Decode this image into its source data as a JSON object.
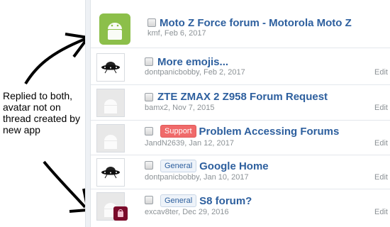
{
  "annotation": {
    "text": "Replied to both, avatar not on thread created by new app"
  },
  "threads": [
    {
      "title": "Moto Z Force forum - Motorola Moto Z",
      "author": "kmf",
      "date": "Feb 6, 2017",
      "edit": "",
      "prefix": "",
      "avatar": "android-icon"
    },
    {
      "title": "More emojis...",
      "author": "dontpanicbobby",
      "date": "Feb 2, 2017",
      "edit": "Edit",
      "prefix": "",
      "avatar": "ufo-icon"
    },
    {
      "title": "ZTE ZMAX 2 Z958 Forum Request",
      "author": "bamx2",
      "date": "Nov 7, 2015",
      "edit": "Edit",
      "prefix": "",
      "avatar": "default-android-icon"
    },
    {
      "title": "Problem Accessing Forums",
      "author": "JandN2639",
      "date": "Jan 12, 2017",
      "edit": "Edit",
      "prefix": "Support",
      "avatar": "default-android-icon"
    },
    {
      "title": "Google Home",
      "author": "dontpanicbobby",
      "date": "Jan 10, 2017",
      "edit": "Edit",
      "prefix": "General",
      "avatar": "ufo-icon"
    },
    {
      "title": "S8 forum?",
      "author": "excav8ter",
      "date": "Dec 29, 2016",
      "edit": "Edit",
      "prefix": "General",
      "avatar": "default-android-icon"
    }
  ],
  "colors": {
    "link": "#2d5f9e",
    "meta": "#8c9296",
    "support": "#f06a6a",
    "android": "#8cbf4a"
  }
}
